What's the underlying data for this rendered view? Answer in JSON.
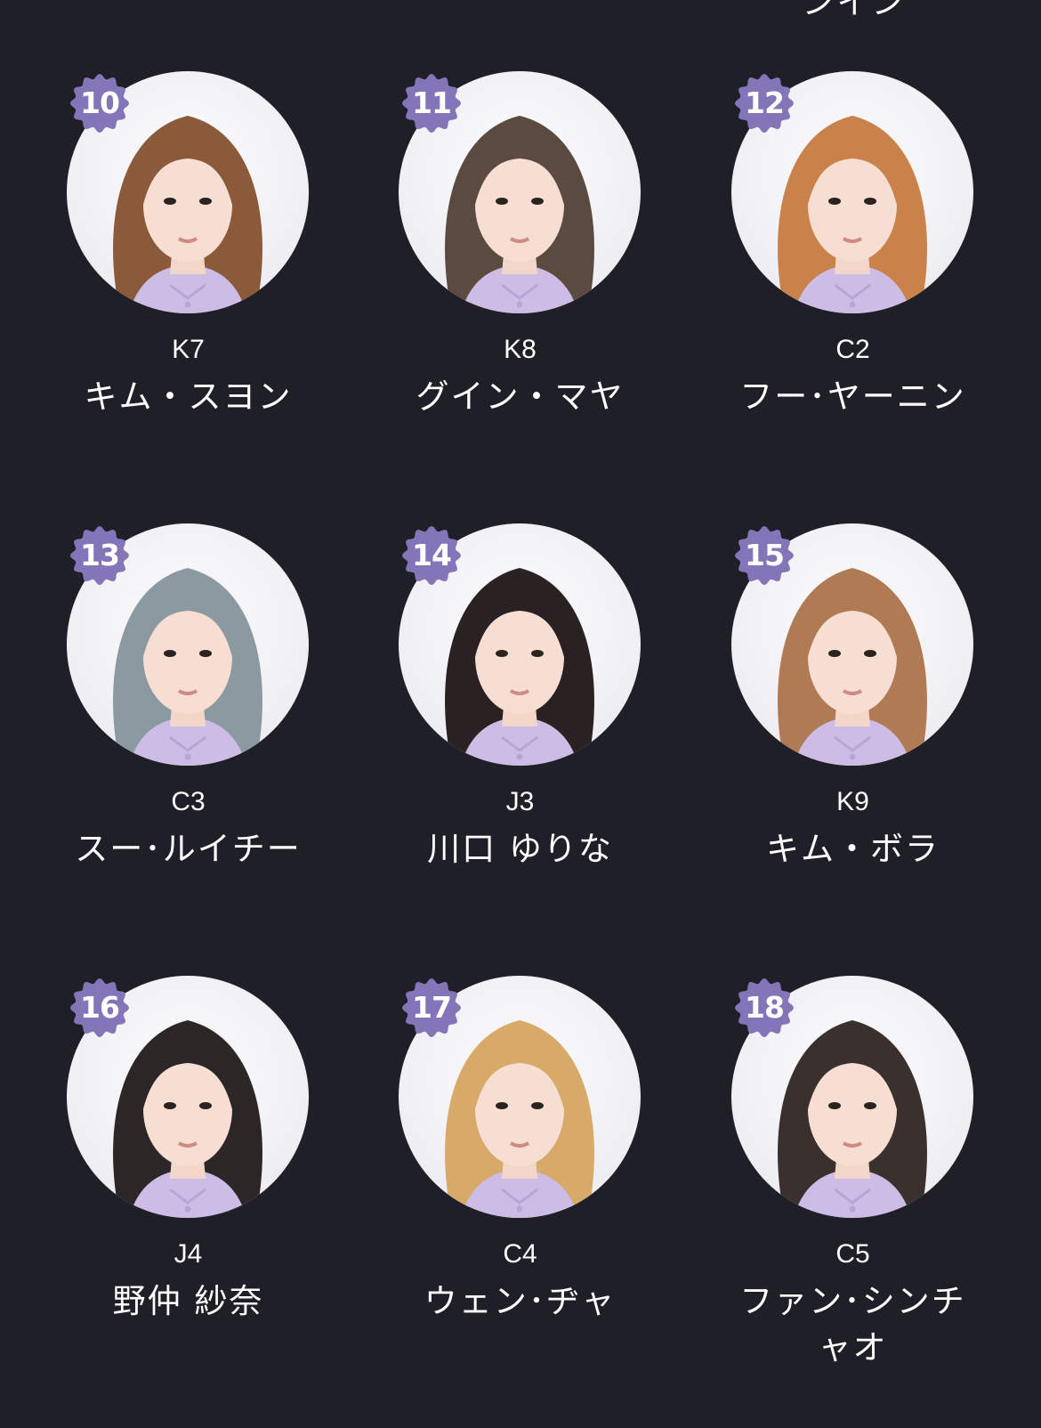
{
  "top_cutoff_text": "ンイン",
  "colors": {
    "background": "#1f1f27",
    "badge": "#8474b8",
    "text": "#ffffff"
  },
  "members": [
    {
      "rank": "10",
      "code": "K7",
      "name": "キム・スヨン",
      "hair": "#8a5a3a"
    },
    {
      "rank": "11",
      "code": "K8",
      "name": "グイン・マヤ",
      "hair": "#5a4a40"
    },
    {
      "rank": "12",
      "code": "C2",
      "name": "フー･ヤーニン",
      "hair": "#c9824a"
    },
    {
      "rank": "13",
      "code": "C3",
      "name": "スー･ルイチー",
      "hair": "#8a9aa0"
    },
    {
      "rank": "14",
      "code": "J3",
      "name": "川口 ゆりな",
      "hair": "#2a2222"
    },
    {
      "rank": "15",
      "code": "K9",
      "name": "キム・ボラ",
      "hair": "#b07a55"
    },
    {
      "rank": "16",
      "code": "J4",
      "name": "野仲 紗奈",
      "hair": "#2d2626"
    },
    {
      "rank": "17",
      "code": "C4",
      "name": "ウェン･ヂャ",
      "hair": "#d8aa6a"
    },
    {
      "rank": "18",
      "code": "C5",
      "name": "ファン･シンチャオ",
      "hair": "#3a302d"
    }
  ]
}
